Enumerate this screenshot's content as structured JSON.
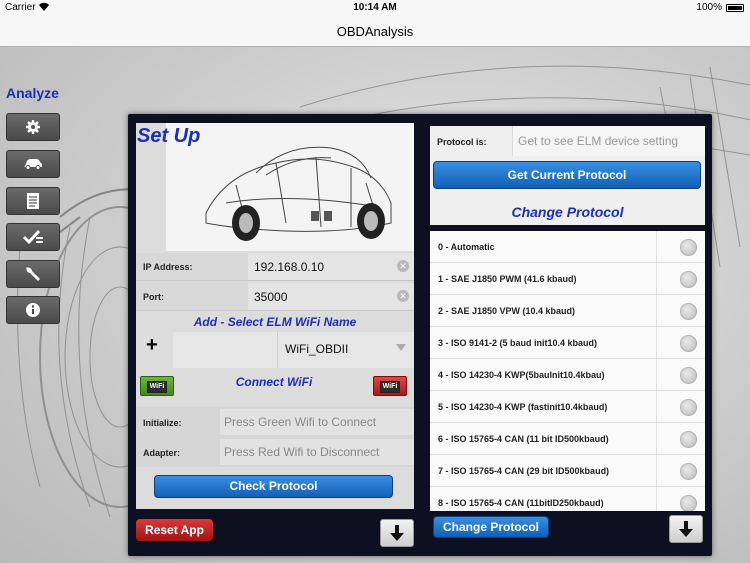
{
  "status_bar": {
    "carrier": "Carrier",
    "time": "10:14 AM",
    "battery": "100%"
  },
  "nav": {
    "title": "OBDAnalysis"
  },
  "sidebar": {
    "title": "Analyze",
    "buttons": [
      "gear-icon",
      "car-icon",
      "document-icon",
      "checklist-icon",
      "wrench-icon",
      "info-icon"
    ]
  },
  "setup": {
    "title": "Set Up",
    "ip_label": "IP Address:",
    "ip_value": "192.168.0.10",
    "port_label": "Port:",
    "port_value": "35000",
    "wifi_section": "Add - Select ELM WiFi Name",
    "wifi_selected": "WiFi_OBDII",
    "connect_title": "Connect WiFi",
    "wifi_badge": "WiFi",
    "initialize_label": "Initialize:",
    "initialize_placeholder": "Press Green Wifi to  Connect",
    "adapter_label": "Adapter:",
    "adapter_placeholder": "Press Red Wifi to Disconnect",
    "check_protocol": "Check Protocol",
    "reset_app": "Reset App"
  },
  "protocol": {
    "label": "Protocol is:",
    "placeholder": "Get to see ELM device setting",
    "get_current": "Get Current Protocol",
    "change_title": "Change Protocol",
    "change_button": "Change Protocol",
    "items": [
      "0 - Automatic",
      "1 - SAE J1850 PWM (41.6 kbaud)",
      "2 - SAE J1850 VPW (10.4 kbaud)",
      "3 - ISO 9141-2 (5 baud init10.4 kbaud)",
      "4 - ISO 14230-4 KWP(5baulnit10.4kbau)",
      "5 - ISO 14230-4 KWP (fastinit10.4kbaud)",
      "6 - ISO 15765-4 CAN (11 bit ID500kbaud)",
      "7 - ISO 15765-4 CAN (29 bit ID500kbaud)",
      "8 - ISO 15765-4 CAN (11bitID250kbaud)"
    ]
  },
  "colors": {
    "accent_blue": "#1b2fb8",
    "button_blue": "#1160b6",
    "danger_red": "#a11313",
    "go_green": "#3f8a18"
  }
}
